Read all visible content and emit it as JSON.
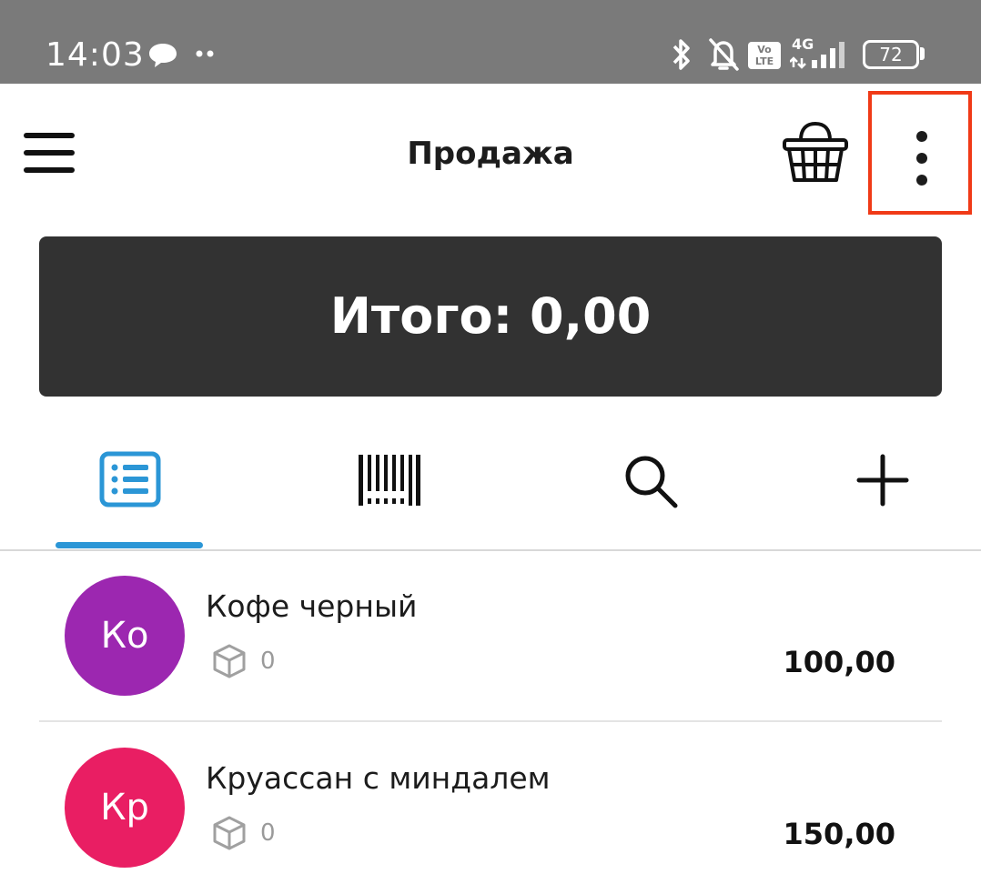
{
  "status_bar": {
    "time": "14:03",
    "network": "4G",
    "volte_label": "Vo\nLTE",
    "battery": "72"
  },
  "toolbar": {
    "title": "Продажа"
  },
  "total": {
    "label": "Итого: 0,00"
  },
  "tabs": [
    {
      "name": "list",
      "icon": "list-icon",
      "active": true
    },
    {
      "name": "barcode",
      "icon": "barcode-icon",
      "active": false
    },
    {
      "name": "search",
      "icon": "search-icon",
      "active": false
    },
    {
      "name": "add",
      "icon": "plus-icon",
      "active": false
    }
  ],
  "products": [
    {
      "initials": "Ко",
      "name": "Кофе черный",
      "stock": "0",
      "price": "100,00",
      "color": "#9c27b0"
    },
    {
      "initials": "Кр",
      "name": "Круассан с миндалем",
      "stock": "0",
      "price": "150,00",
      "color": "#e91e63"
    }
  ],
  "colors": {
    "accent": "#2b96d6",
    "highlight": "#f03a17",
    "status_bar": "#7a7a7a",
    "total_bg": "#323232"
  }
}
